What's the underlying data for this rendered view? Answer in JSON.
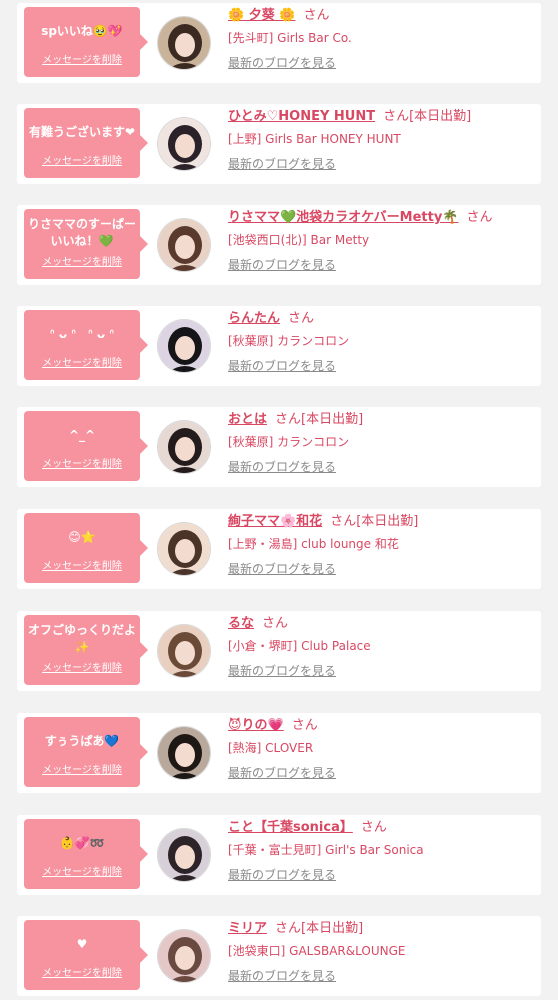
{
  "blog_link_label": "最新のブログを見る",
  "delete_label": "メッセージを削除",
  "colors": {
    "bubble": "#f7939f",
    "name_text": "#d94862",
    "link_gray": "#8a8a8a",
    "card_bg": "#ffffff",
    "page_bg": "#f2f2f2"
  },
  "messages": [
    {
      "message": "spいいね🥹💖",
      "name": "🌼 夕葵 🌼",
      "suffix": "さん",
      "shop": "[先斗町] Girls Bar Co.",
      "avatar_icon": "profile-photo-icon"
    },
    {
      "message": "有難うございます❤",
      "name": "ひとみ♡HONEY HUNT",
      "suffix": "さん[本日出勤]",
      "shop": "[上野] Girls Bar HONEY HUNT",
      "avatar_icon": "profile-photo-icon"
    },
    {
      "message": "りさママのすーぱーいいね！💚",
      "name": "りさママ💚池袋カラオケバーMetty🌴",
      "suffix": "さん",
      "shop": "[池袋西口(北)] Bar Metty",
      "avatar_icon": "profile-photo-icon"
    },
    {
      "message": "ᐢ ᴗ ᐢ　ᐢ ᴗ ᐢ",
      "name": "らんたん",
      "suffix": "さん",
      "shop": "[秋葉原] カランコロン",
      "avatar_icon": "profile-photo-icon"
    },
    {
      "message": "^_^",
      "name": "おとは",
      "suffix": "さん[本日出勤]",
      "shop": "[秋葉原] カランコロン",
      "avatar_icon": "profile-photo-icon"
    },
    {
      "message": "😊⭐",
      "name": "絢子ママ🌸和花",
      "suffix": "さん[本日出勤]",
      "shop": "[上野・湯島] club lounge 和花",
      "avatar_icon": "profile-photo-icon"
    },
    {
      "message": "オフごゆっくりだよ✨",
      "name": "るな",
      "suffix": "さん",
      "shop": "[小倉・堺町] Club Palace",
      "avatar_icon": "profile-photo-icon"
    },
    {
      "message": "すぅうぱあ💙",
      "name": "😈りの💗",
      "suffix": "さん",
      "shop": "[熱海] CLOVER",
      "avatar_icon": "profile-photo-icon"
    },
    {
      "message": "👶💞➿",
      "name": "こと【千葉sonica】",
      "suffix": "さん",
      "shop": "[千葉・富士見町] Girl's Bar Sonica",
      "avatar_icon": "profile-photo-icon"
    },
    {
      "message": "♥",
      "name": "ミリア",
      "suffix": "さん[本日出勤]",
      "shop": "[池袋東口] GALSBAR&LOUNGE",
      "avatar_icon": "profile-photo-icon"
    }
  ]
}
